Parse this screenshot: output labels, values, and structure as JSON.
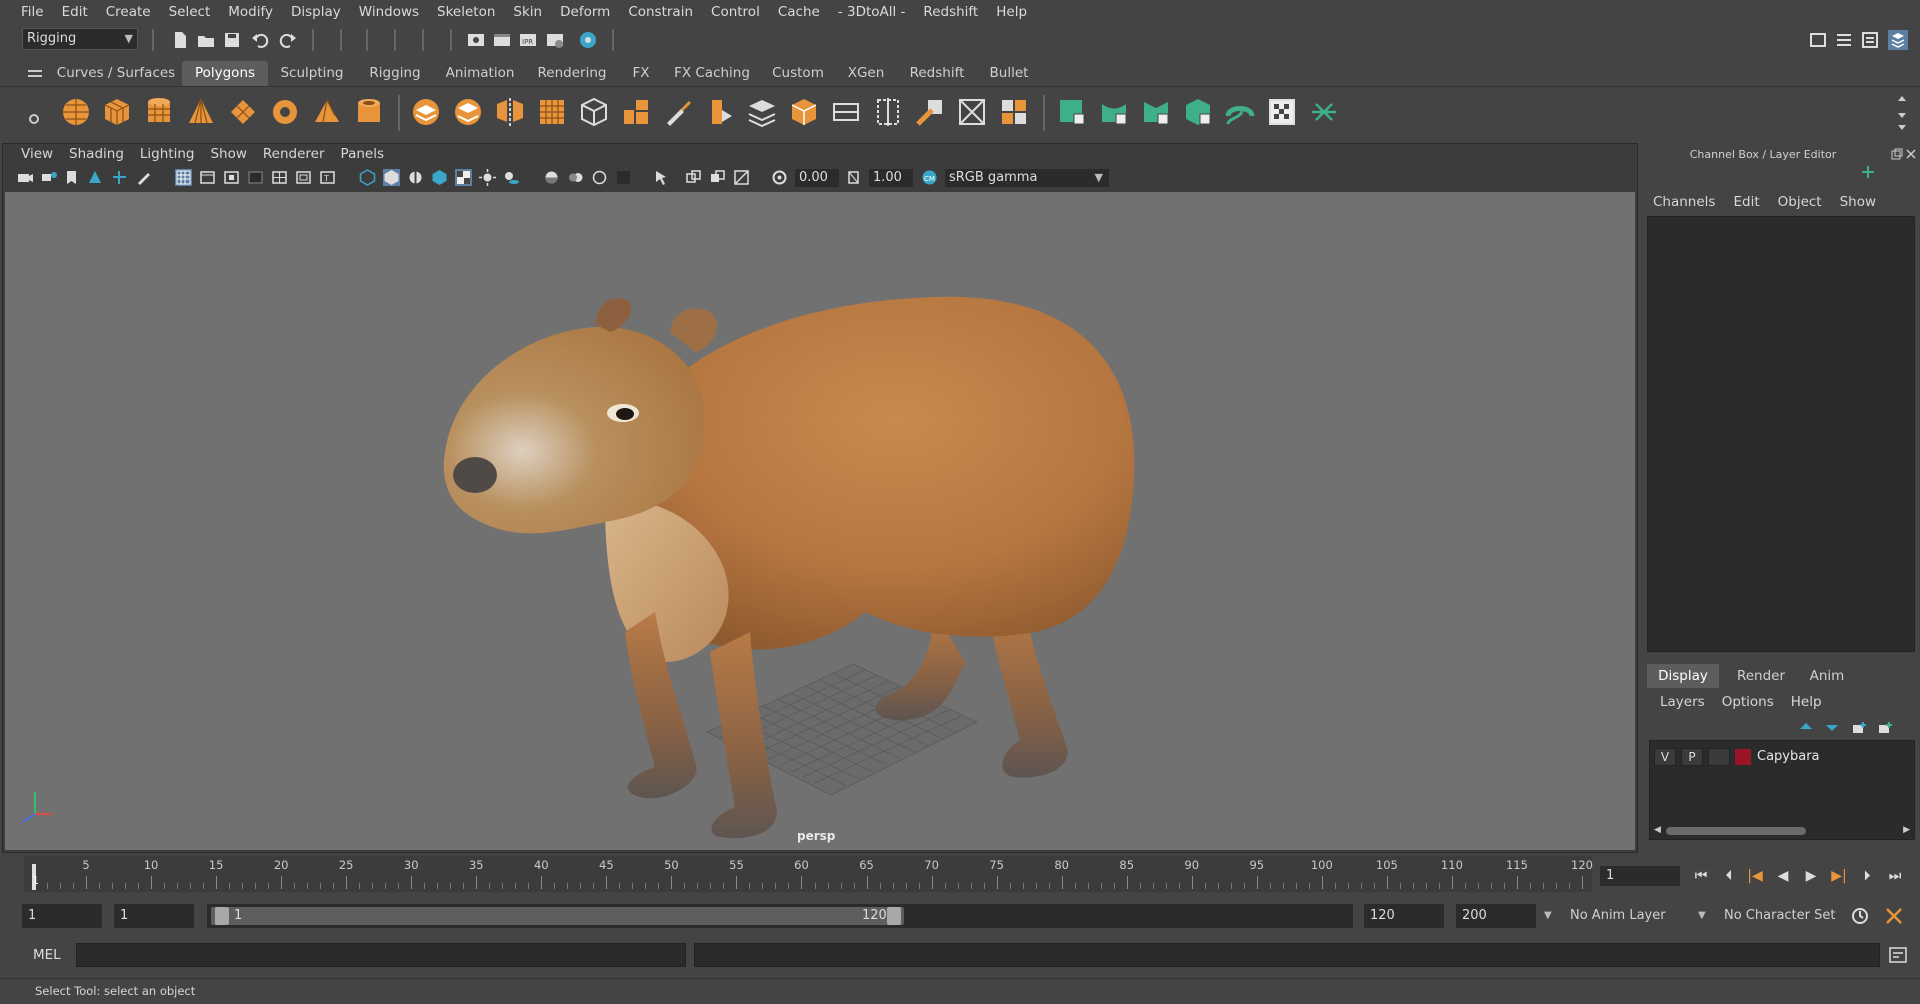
{
  "menubar": {
    "items": [
      "File",
      "Edit",
      "Create",
      "Select",
      "Modify",
      "Display",
      "Windows",
      "Skeleton",
      "Skin",
      "Deform",
      "Constrain",
      "Control",
      "Cache",
      "- 3DtoAll -",
      "Redshift",
      "Help"
    ]
  },
  "statusline": {
    "mode": "Rigging"
  },
  "shelf": {
    "tabs": [
      "Curves / Surfaces",
      "Polygons",
      "Sculpting",
      "Rigging",
      "Animation",
      "Rendering",
      "FX",
      "FX Caching",
      "Custom",
      "XGen",
      "Redshift",
      "Bullet"
    ],
    "active_tab": "Polygons",
    "colors": {
      "orange": "#e8943a",
      "green": "#3fae8a"
    }
  },
  "viewport": {
    "menu": [
      "View",
      "Shading",
      "Lighting",
      "Show",
      "Renderer",
      "Panels"
    ],
    "exposure": "0.00",
    "gamma": "1.00",
    "color_space": "sRGB gamma",
    "camera": "persp"
  },
  "channel_box": {
    "title": "Channel Box / Layer Editor",
    "menu": [
      "Channels",
      "Edit",
      "Object",
      "Show"
    ]
  },
  "layer_editor": {
    "tabs": [
      "Display",
      "Render",
      "Anim"
    ],
    "active_tab": "Display",
    "menu": [
      "Layers",
      "Options",
      "Help"
    ],
    "layer": {
      "visible": "V",
      "playback": "P",
      "name": "Capybara",
      "color": "#9a1428"
    }
  },
  "timeslider": {
    "ticks": [
      "5",
      "10",
      "15",
      "20",
      "25",
      "30",
      "35",
      "40",
      "45",
      "50",
      "55",
      "60",
      "65",
      "70",
      "75",
      "80",
      "85",
      "90",
      "95",
      "100",
      "105",
      "110",
      "115",
      "120"
    ],
    "current_frame_marker": "1",
    "current_frame": "1"
  },
  "range": {
    "anim_start": "1",
    "play_start": "1",
    "slider_start": "1",
    "slider_end": "120",
    "play_end": "120",
    "anim_end": "200",
    "anim_layer": "No Anim Layer",
    "character_set": "No Character Set"
  },
  "command_line": {
    "label": "MEL"
  },
  "help_line": {
    "text": "Select Tool: select an object"
  }
}
